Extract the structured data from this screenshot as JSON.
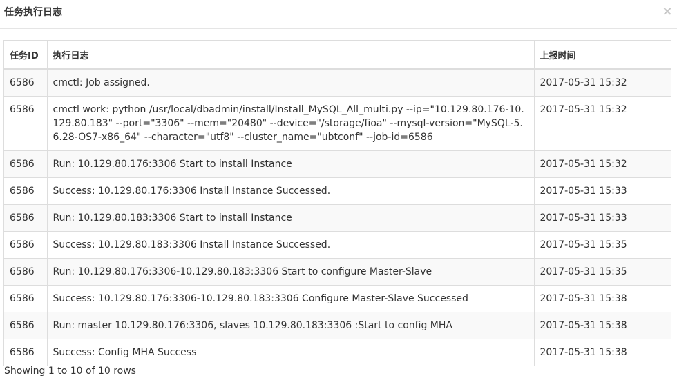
{
  "modal": {
    "title": "任务执行日志",
    "close_label": "×"
  },
  "table": {
    "headers": {
      "task_id": "任务ID",
      "log": "执行日志",
      "report_time": "上报时间"
    },
    "rows": [
      {
        "task_id": "6586",
        "log": "cmctl: Job assigned.",
        "time": "2017-05-31 15:32"
      },
      {
        "task_id": "6586",
        "log": "cmctl work: python /usr/local/dbadmin/install/Install_MySQL_All_multi.py --ip=\"10.129.80.176-10.129.80.183\" --port=\"3306\" --mem=\"20480\" --device=\"/storage/fioa\" --mysql-version=\"MySQL-5.6.28-OS7-x86_64\" --character=\"utf8\" --cluster_name=\"ubtconf\" --job-id=6586",
        "time": "2017-05-31 15:32"
      },
      {
        "task_id": "6586",
        "log": "Run: 10.129.80.176:3306 Start to install Instance",
        "time": "2017-05-31 15:32"
      },
      {
        "task_id": "6586",
        "log": "Success: 10.129.80.176:3306 Install Instance Successed.",
        "time": "2017-05-31 15:33"
      },
      {
        "task_id": "6586",
        "log": "Run: 10.129.80.183:3306 Start to install Instance",
        "time": "2017-05-31 15:33"
      },
      {
        "task_id": "6586",
        "log": "Success: 10.129.80.183:3306 Install Instance Successed.",
        "time": "2017-05-31 15:35"
      },
      {
        "task_id": "6586",
        "log": "Run: 10.129.80.176:3306-10.129.80.183:3306 Start to configure Master-Slave",
        "time": "2017-05-31 15:35"
      },
      {
        "task_id": "6586",
        "log": "Success: 10.129.80.176:3306-10.129.80.183:3306 Configure Master-Slave Successed",
        "time": "2017-05-31 15:38"
      },
      {
        "task_id": "6586",
        "log": "Run: master 10.129.80.176:3306, slaves 10.129.80.183:3306 :Start to config MHA",
        "time": "2017-05-31 15:38"
      },
      {
        "task_id": "6586",
        "log": "Success: Config MHA Success",
        "time": "2017-05-31 15:38"
      }
    ]
  },
  "pagination": {
    "info": "Showing 1 to 10 of 10 rows"
  }
}
